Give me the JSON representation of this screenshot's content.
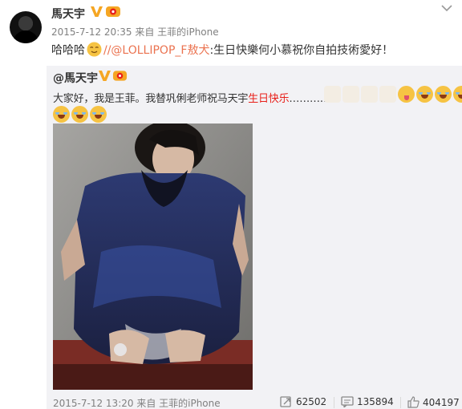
{
  "post": {
    "username": "馬天宇",
    "meta": "2015-7-12 20:35 来自 王菲的iPhone",
    "text_before": "哈哈哈",
    "text_link": "//@LOLLIPOP_F敖犬",
    "text_after": ":生日快樂何小慕祝你自拍技術愛好！"
  },
  "original": {
    "username": "@馬天宇",
    "text_main": "大家好，我是王菲。我替巩俐老师祝马天宇",
    "text_red": "生日快乐",
    "text_dots": "…………..",
    "meta": "2015-7-12 13:20 来自 王菲的iPhone",
    "reposts": "62502",
    "comments": "135894",
    "likes": "404197"
  },
  "colors": {
    "link": "#eb7350",
    "red_text": "#e8201a",
    "embed_bg": "#f2f2f5"
  },
  "icons": [
    "verified-v-icon",
    "vip-badge-icon",
    "chevron-down-icon",
    "repost-icon",
    "comment-icon",
    "like-icon"
  ]
}
